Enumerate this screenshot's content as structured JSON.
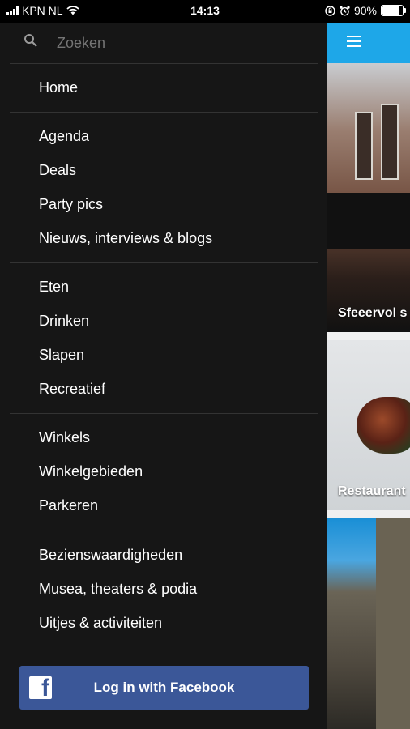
{
  "status_bar": {
    "carrier": "KPN NL",
    "time": "14:13",
    "battery": "90%"
  },
  "drawer": {
    "search": {
      "placeholder": "Zoeken"
    },
    "groups": [
      {
        "items": [
          "Home"
        ]
      },
      {
        "items": [
          "Agenda",
          "Deals",
          "Party pics",
          "Nieuws, interviews & blogs"
        ]
      },
      {
        "items": [
          "Eten",
          "Drinken",
          "Slapen",
          "Recreatief"
        ]
      },
      {
        "items": [
          "Winkels",
          "Winkelgebieden",
          "Parkeren"
        ]
      },
      {
        "items": [
          "Bezienswaardigheden",
          "Musea, theaters & podia",
          "Uitjes & activiteiten"
        ]
      }
    ],
    "facebook_button": {
      "label": "Log in with Facebook"
    }
  },
  "content": {
    "header_color": "#1ea7e8",
    "cards": [
      {
        "title": "Sfeeervol s"
      },
      {
        "title": "Restaurant"
      },
      {
        "title": ""
      }
    ]
  },
  "colors": {
    "drawer_bg": "#161616",
    "accent": "#1ea7e8",
    "facebook": "#3b5798"
  }
}
